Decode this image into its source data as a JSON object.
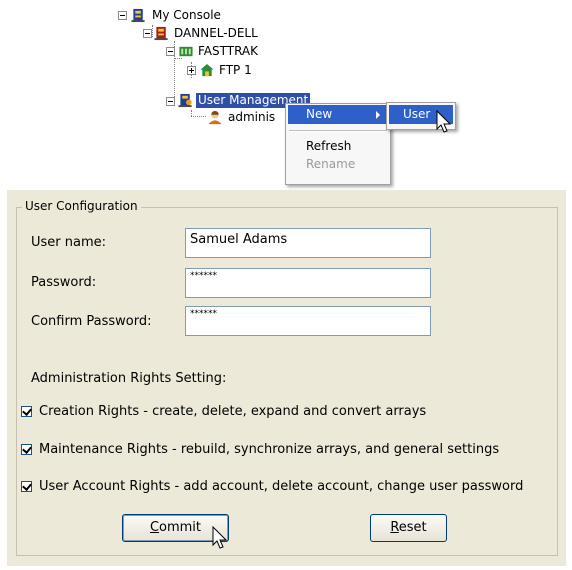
{
  "tree": {
    "root": "My Console",
    "computer": "DANNEL-DELL",
    "controller": "FASTTRAK",
    "ftp": "FTP 1",
    "user_mgmt": "User Management",
    "admin_user": "adminis"
  },
  "context_menu": {
    "new": "New",
    "refresh": "Refresh",
    "rename": "Rename"
  },
  "submenu": {
    "user": "User"
  },
  "config": {
    "group_title": "User Configuration",
    "username_label": "User name:",
    "username_value": "Samuel Adams",
    "password_label": "Password:",
    "password_value": "******",
    "confirm_label": "Confirm Password:",
    "confirm_value": "******",
    "rights_heading": "Administration Rights Setting:",
    "rights": [
      {
        "label": "Creation Rights - create, delete, expand and convert arrays",
        "checked": true
      },
      {
        "label": "Maintenance Rights - rebuild, synchronize arrays, and general settings",
        "checked": true
      },
      {
        "label": "User Account Rights - add account, delete account, change user password",
        "checked": true
      }
    ],
    "commit": {
      "mnemonic": "C",
      "rest": "ommit"
    },
    "reset": {
      "mnemonic": "R",
      "rest": "eset"
    }
  }
}
